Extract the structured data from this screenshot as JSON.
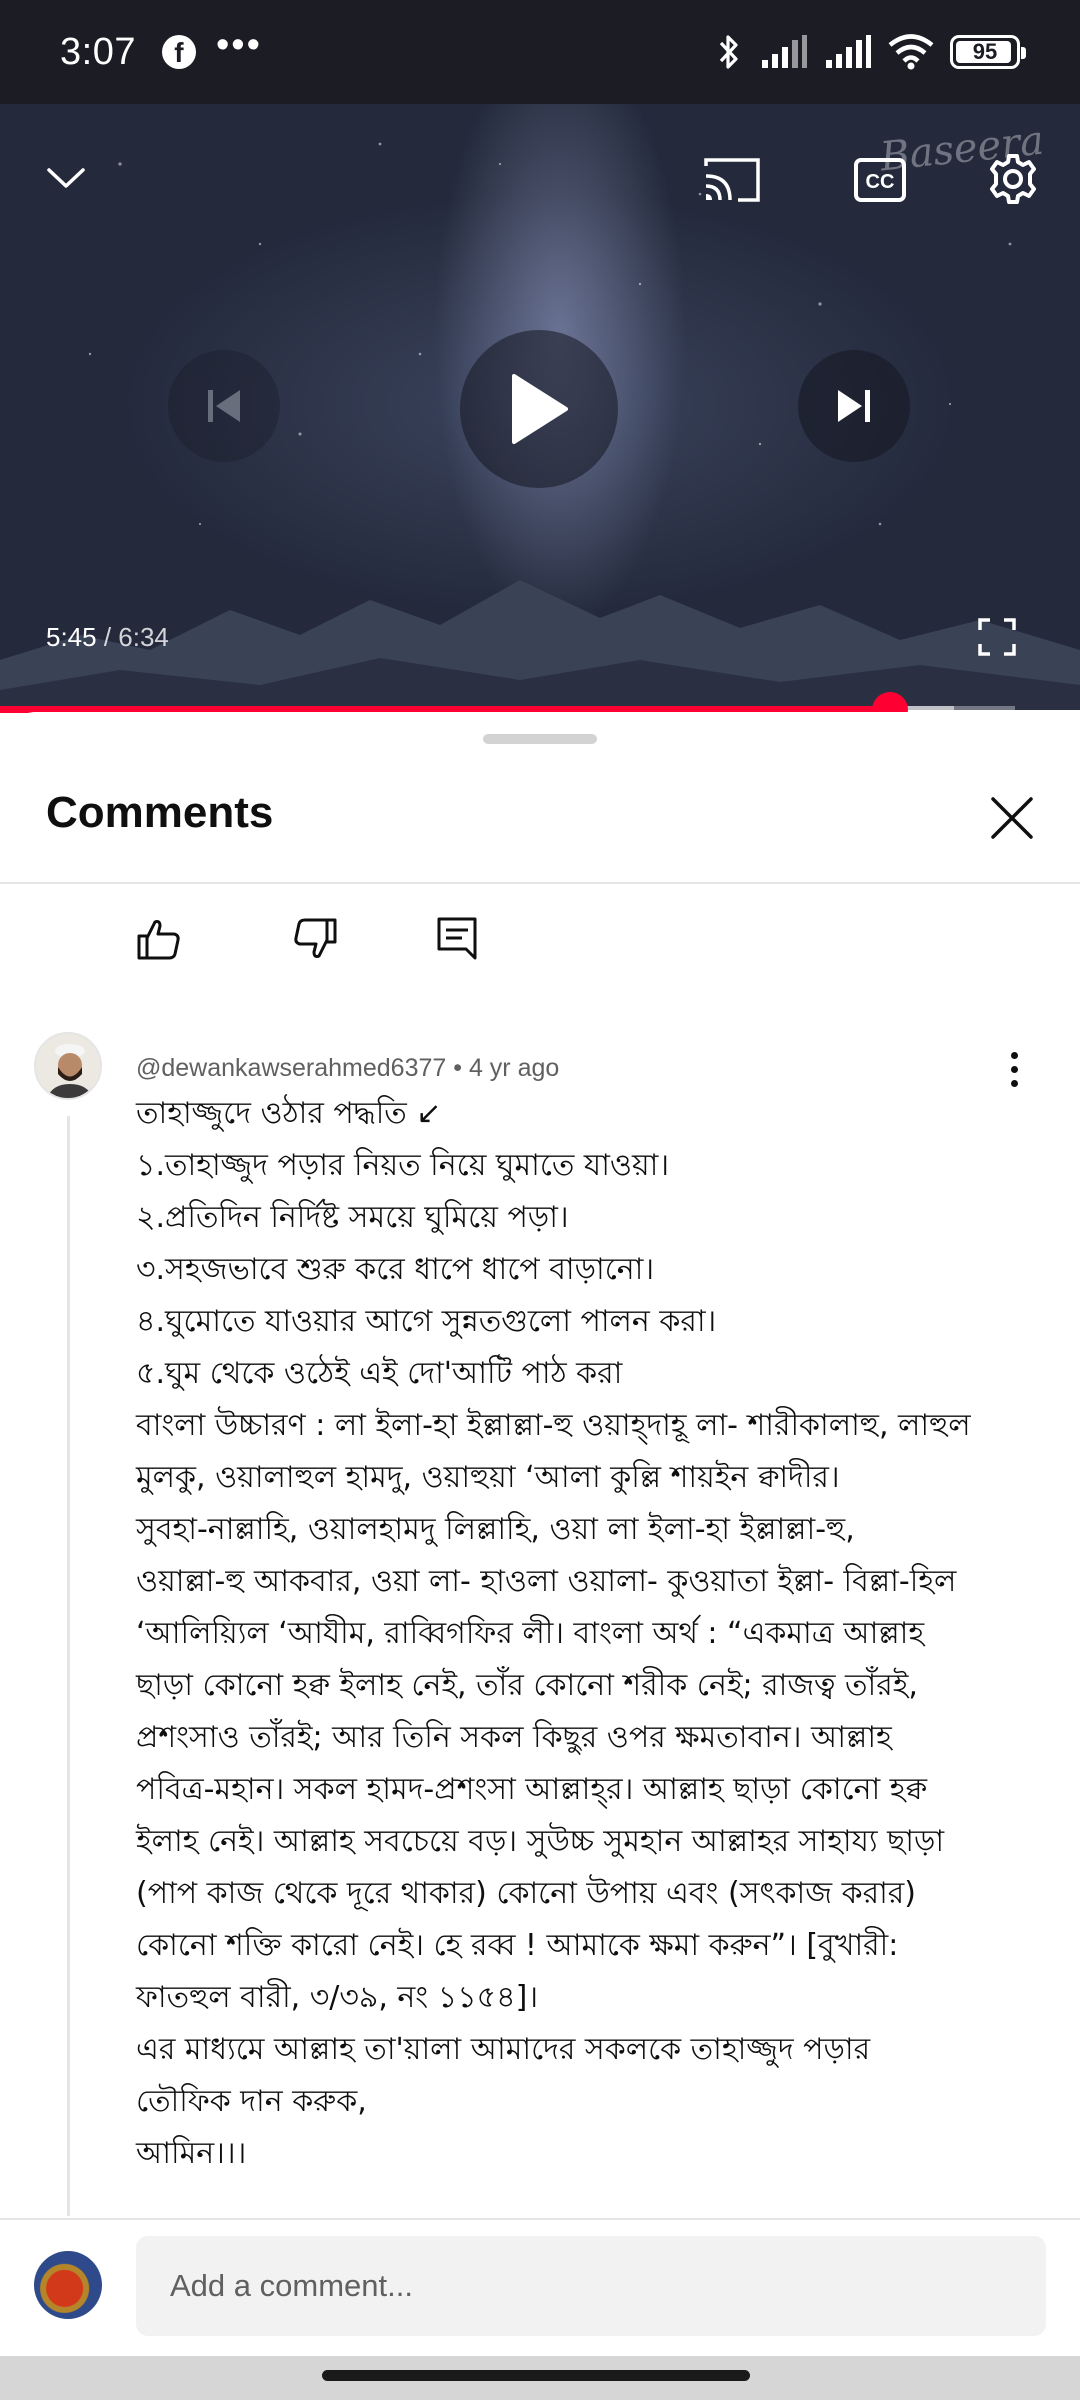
{
  "status_bar": {
    "time": "3:07",
    "notification_icons": [
      "facebook-icon",
      "more-icon"
    ],
    "more_glyph": "•••",
    "battery": "95",
    "battery_level": 0.95
  },
  "player": {
    "watermark": "Baseera",
    "current_time": "5:45",
    "separator": " / ",
    "duration": "6:34",
    "progress_fraction": 0.877,
    "buffered_fraction": 0.94,
    "accent_color": "#ff0033",
    "controls": [
      "collapse-icon",
      "cast-icon",
      "captions-icon",
      "settings-icon",
      "previous-icon",
      "play-icon",
      "next-icon",
      "fullscreen-icon"
    ],
    "captions_label": "CC"
  },
  "comments_panel": {
    "title": "Comments"
  },
  "comment": {
    "author": "@dewankawserahmed6377",
    "age": "4 yr ago",
    "lines": [
      "তাহাজ্জুদে ওঠার পদ্ধতি ↙",
      "১.তাহাজ্জুদ পড়ার নিয়ত নিয়ে ঘুমাতে যাওয়া।",
      "২.প্রতিদিন নির্দিষ্ট সময়ে ঘুমিয়ে পড়া।",
      "৩.সহজভাবে শুরু করে ধাপে ধাপে বাড়ানো।",
      "৪.ঘুমোতে যাওয়ার আগে সুন্নতগুলো পালন করা।",
      "৫.ঘুম থেকে ওঠেই এই দো'আটি পাঠ করা",
      "বাংলা উচ্চারণ : লা ইলা-হা ইল্লাল্লা-হু ওয়াহ্‌দাহূ লা- শারীকালাহু, লাহুল",
      "মুলকু, ওয়ালাহুল হামদু, ওয়াহুয়া ‘আলা কুল্লি শায়ইন ক্বাদীর।",
      "সুবহা-নাল্লাহি, ওয়ালহামদু লিল্লাহি, ওয়া লা ইলা-হা ইল্লাল্লা-হু,",
      "ওয়াল্লা-হু আকবার, ওয়া লা- হাওলা ওয়ালা- কুওয়াতা ইল্লা- বিল্লা-হিল",
      "‘আলিয়্যিল ‘আযীম, রাব্বিগফির লী। বাংলা অর্থ : “একমাত্র আল্লাহ",
      "ছাড়া কোনো হক্ব ইলাহ নেই, তাঁর কোনো শরীক নেই; রাজত্ব তাঁরই,",
      "প্রশংসাও তাঁরই; আর তিনি সকল কিছুর ওপর ক্ষমতাবান। আল্লাহ",
      "পবিত্র-মহান। সকল হামদ-প্রশংসা আল্লাহ্‌র। আল্লাহ ছাড়া কোনো হক্ব",
      "ইলাহ নেই। আল্লাহ সবচেয়ে বড়। সুউচ্চ সুমহান আল্লাহর সাহায্য ছাড়া",
      "(পাপ কাজ থেকে দূরে থাকার) কোনো উপায় এবং (সৎকাজ করার)",
      "কোনো শক্তি কারো নেই। হে রব্ব ! আমাকে ক্ষমা করুন”। [বুখারী:",
      "ফাতহুল বারী, ৩/৩৯, নং ১১৫৪]।",
      "এর মাধ্যমে আল্লাহ তা'য়ালা আমাদের সকলকে তাহাজ্জুদ পড়ার",
      "তৌফিক দান করুক,",
      "আমিন।।।"
    ],
    "actions": [
      "like-icon",
      "dislike-icon",
      "reply-icon"
    ]
  },
  "composer": {
    "placeholder": "Add a comment..."
  }
}
